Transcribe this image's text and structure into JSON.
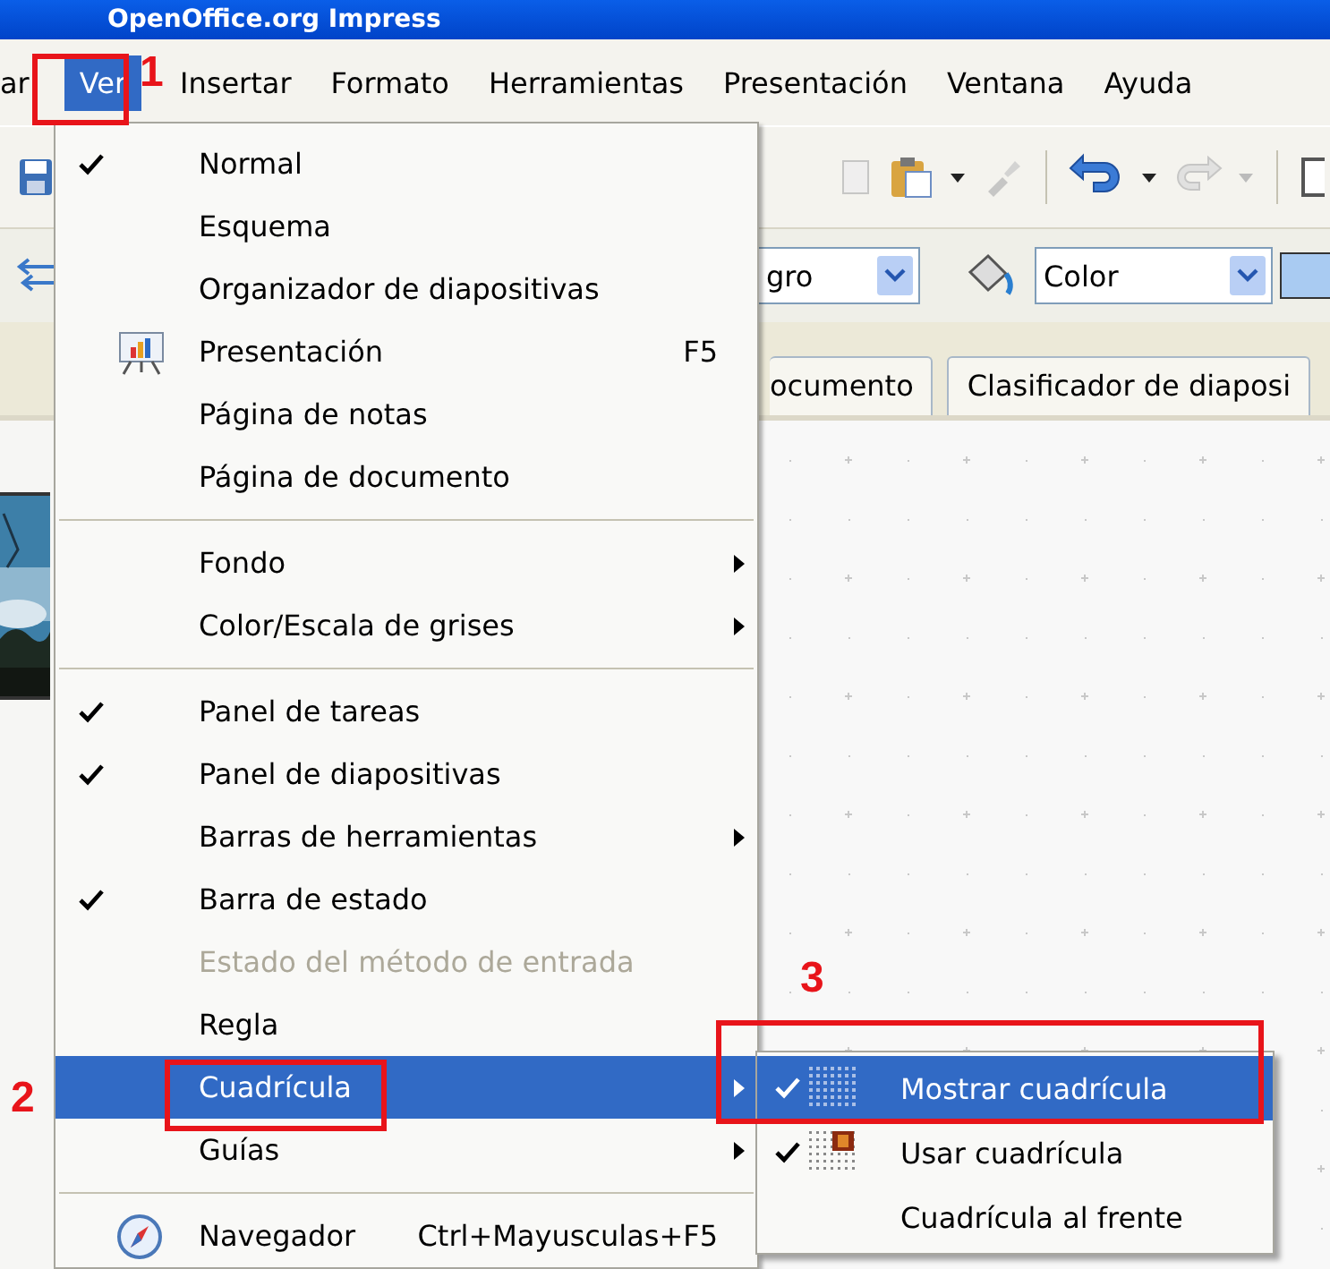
{
  "window": {
    "title": "OpenOffice.org Impress"
  },
  "menubar": [
    {
      "label": "ar",
      "selected": false
    },
    {
      "label": "Ver",
      "selected": true
    },
    {
      "label": "Insertar",
      "selected": false
    },
    {
      "label": "Formato",
      "selected": false
    },
    {
      "label": "Herramientas",
      "selected": false
    },
    {
      "label": "Presentación",
      "selected": false
    },
    {
      "label": "Ventana",
      "selected": false
    },
    {
      "label": "Ayuda",
      "selected": false
    }
  ],
  "toolbar": {
    "dropdown_1": "gro",
    "dropdown_2": "Color"
  },
  "tabs": [
    {
      "label": "ocumento"
    },
    {
      "label": "Clasificador de diaposi"
    }
  ],
  "menu": {
    "items": [
      {
        "kind": "item",
        "label": "Normal",
        "checked": true,
        "selected": false,
        "disabled": false,
        "submenu": false
      },
      {
        "kind": "item",
        "label": "Esquema",
        "checked": false,
        "selected": false,
        "disabled": false,
        "submenu": false
      },
      {
        "kind": "item",
        "label": "Organizador de diapositivas",
        "checked": false,
        "selected": false,
        "disabled": false,
        "submenu": false
      },
      {
        "kind": "item",
        "label": "Presentación",
        "checked": false,
        "selected": false,
        "disabled": false,
        "submenu": false,
        "shortcut": "F5"
      },
      {
        "kind": "item",
        "label": "Página de notas",
        "checked": false,
        "selected": false,
        "disabled": false,
        "submenu": false
      },
      {
        "kind": "item",
        "label": "Página de documento",
        "checked": false,
        "selected": false,
        "disabled": false,
        "submenu": false
      },
      {
        "kind": "separator"
      },
      {
        "kind": "item",
        "label": "Fondo",
        "checked": false,
        "selected": false,
        "disabled": false,
        "submenu": true
      },
      {
        "kind": "item",
        "label": "Color/Escala de grises",
        "checked": false,
        "selected": false,
        "disabled": false,
        "submenu": true
      },
      {
        "kind": "separator"
      },
      {
        "kind": "item",
        "label": "Panel de tareas",
        "checked": true,
        "selected": false,
        "disabled": false,
        "submenu": false
      },
      {
        "kind": "item",
        "label": "Panel de diapositivas",
        "checked": true,
        "selected": false,
        "disabled": false,
        "submenu": false
      },
      {
        "kind": "item",
        "label": "Barras de herramientas",
        "checked": false,
        "selected": false,
        "disabled": false,
        "submenu": true
      },
      {
        "kind": "item",
        "label": "Barra de estado",
        "checked": true,
        "selected": false,
        "disabled": false,
        "submenu": false
      },
      {
        "kind": "item",
        "label": "Estado del método de entrada",
        "checked": false,
        "selected": false,
        "disabled": true,
        "submenu": false
      },
      {
        "kind": "item",
        "label": "Regla",
        "checked": false,
        "selected": false,
        "disabled": false,
        "submenu": false
      },
      {
        "kind": "item",
        "label": "Cuadrícula",
        "checked": false,
        "selected": true,
        "disabled": false,
        "submenu": true
      },
      {
        "kind": "item",
        "label": "Guías",
        "checked": false,
        "selected": false,
        "disabled": false,
        "submenu": true
      },
      {
        "kind": "separator"
      },
      {
        "kind": "item",
        "label": "Navegador",
        "checked": false,
        "selected": false,
        "disabled": false,
        "submenu": false,
        "shortcut": "Ctrl+Mayusculas+F5"
      }
    ]
  },
  "submenu": {
    "items": [
      {
        "label": "Mostrar cuadrícula",
        "checked": true,
        "selected": true
      },
      {
        "label": "Usar cuadrícula",
        "checked": true,
        "selected": false
      },
      {
        "label": "Cuadrícula al frente",
        "checked": false,
        "selected": false
      }
    ]
  },
  "annotations": [
    {
      "label": "1"
    },
    {
      "label": "2"
    },
    {
      "label": "3"
    }
  ]
}
